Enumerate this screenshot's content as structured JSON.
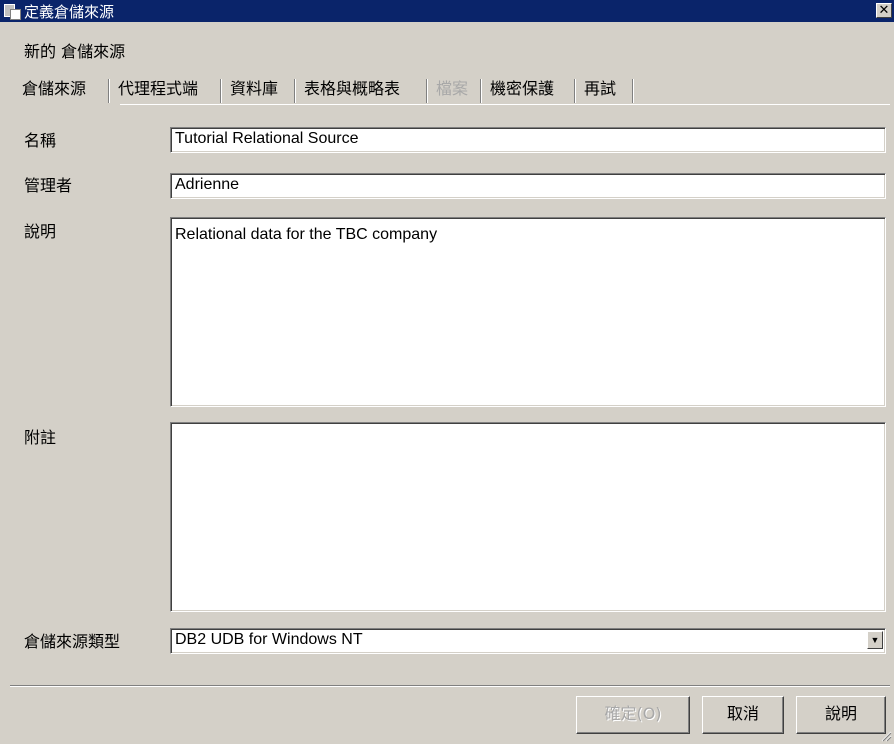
{
  "window": {
    "title": "定義倉儲來源",
    "close_label": "✕"
  },
  "subtitle": "新的 倉儲來源",
  "tabs": [
    {
      "label": "倉儲來源",
      "state": "active"
    },
    {
      "label": "代理程式端",
      "state": "normal"
    },
    {
      "label": "資料庫",
      "state": "normal"
    },
    {
      "label": "表格與概略表",
      "state": "normal"
    },
    {
      "label": "檔案",
      "state": "disabled"
    },
    {
      "label": "機密保護",
      "state": "normal"
    },
    {
      "label": "再試",
      "state": "normal"
    }
  ],
  "form": {
    "name_label": "名稱",
    "name_value": "Tutorial Relational Source",
    "admin_label": "管理者",
    "admin_value": "Adrienne",
    "description_label": "說明",
    "description_value": "Relational data for the TBC company",
    "notes_label": "附註",
    "notes_value": "",
    "type_label": "倉儲來源類型",
    "type_value": "DB2 UDB for Windows NT",
    "type_arrow": "▼"
  },
  "buttons": {
    "ok": "確定(O)",
    "cancel": "取消",
    "help": "說明"
  }
}
